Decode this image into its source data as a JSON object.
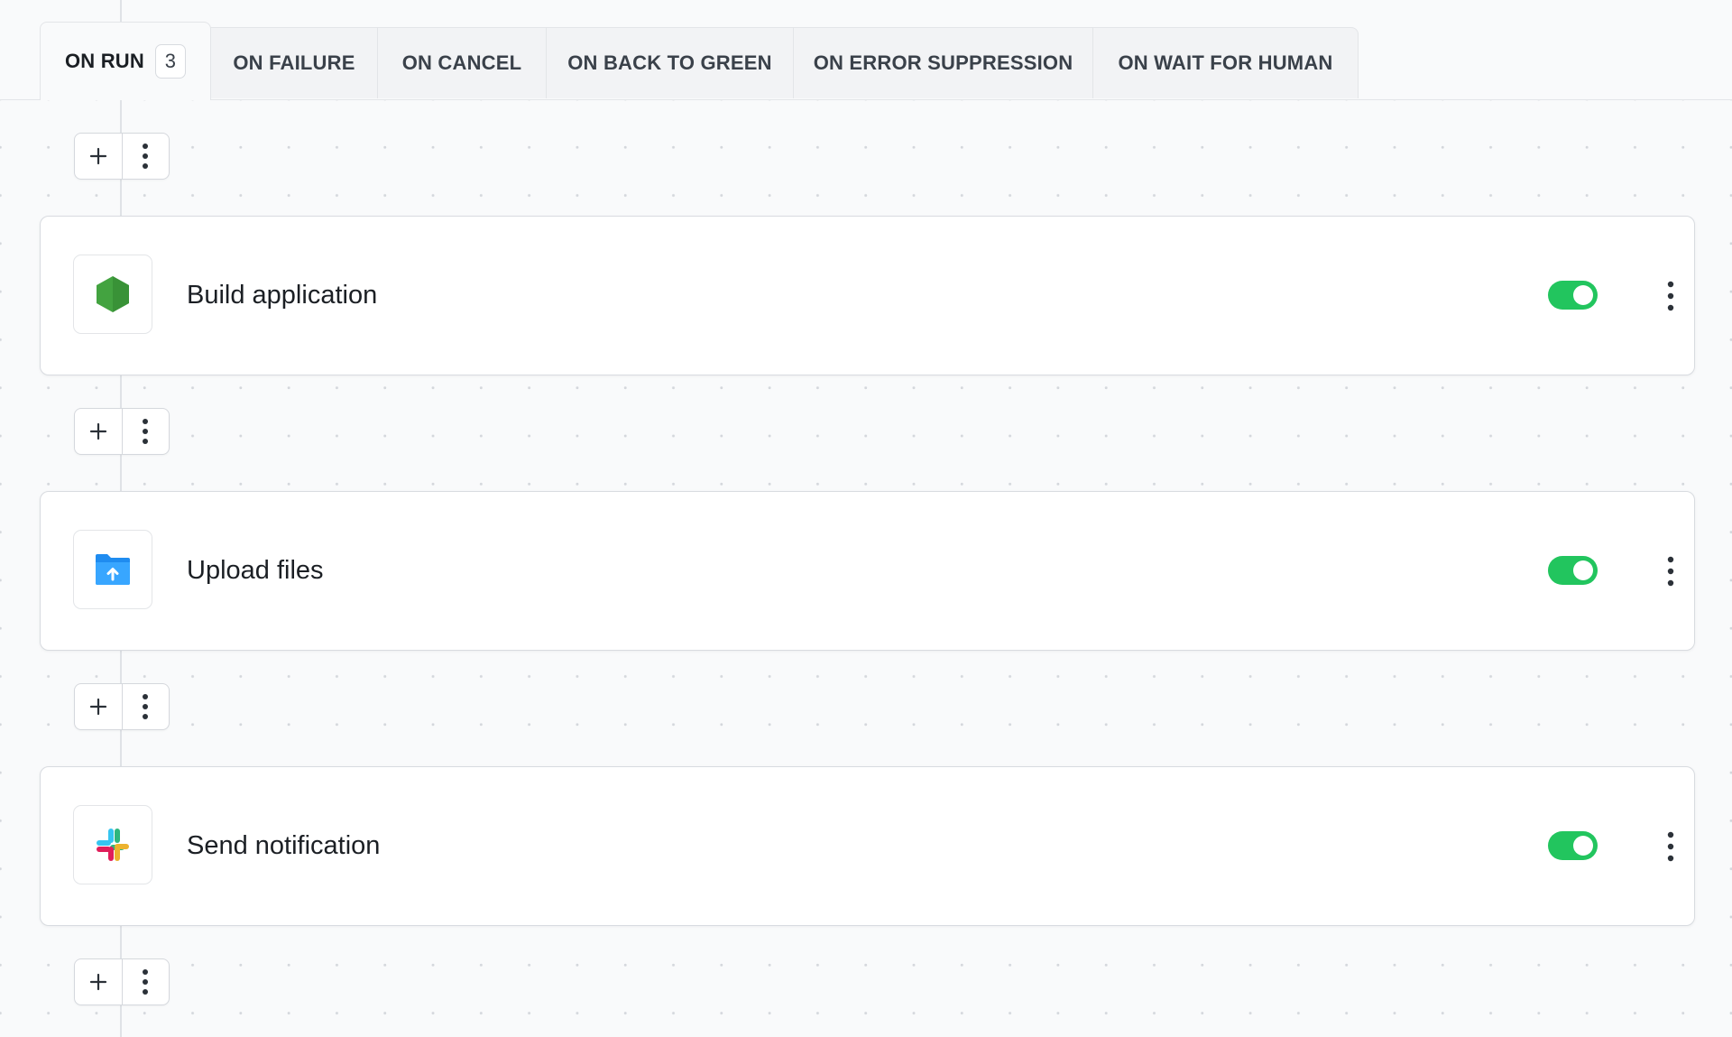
{
  "tabs": [
    {
      "label": "ON RUN",
      "count": "3",
      "active": true
    },
    {
      "label": "ON FAILURE"
    },
    {
      "label": "ON CANCEL"
    },
    {
      "label": "ON BACK TO GREEN"
    },
    {
      "label": "ON ERROR SUPPRESSION"
    },
    {
      "label": "ON WAIT FOR HUMAN"
    }
  ],
  "actions": [
    {
      "title": "Build application",
      "icon": "nodejs-hexagon-icon",
      "enabled": true
    },
    {
      "title": "Upload files",
      "icon": "upload-folder-icon",
      "enabled": true
    },
    {
      "title": "Send notification",
      "icon": "slack-icon",
      "enabled": true
    }
  ],
  "colors": {
    "toggle_on": "#22c55e",
    "node_green": "#3e9e3a",
    "folder_blue": "#1f8cf0"
  }
}
